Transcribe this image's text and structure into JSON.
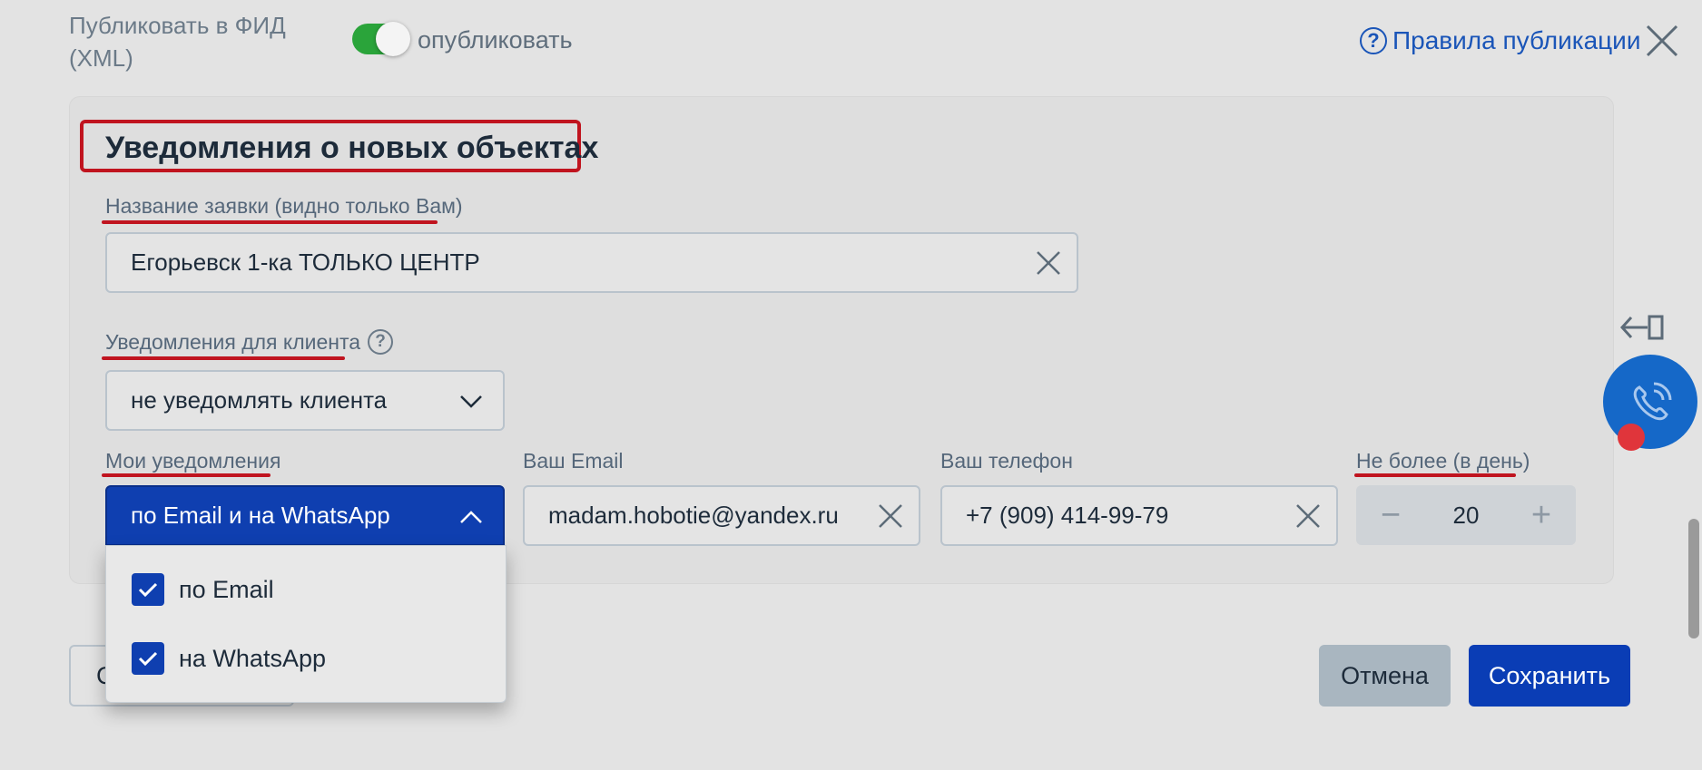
{
  "header": {
    "feed_label": "Публиковать в ФИД (XML)",
    "publish_toggle_label": "опубликовать",
    "publish_toggle_on": true,
    "rules_link": "Правила публикации",
    "help_glyph": "?"
  },
  "section": {
    "title": "Уведомления о новых объектах",
    "request_name_label": "Название заявки (видно только Вам)",
    "request_name_value": "Егорьевск 1-ка ТОЛЬКО ЦЕНТР",
    "client_notify_label": "Уведомления для клиента",
    "client_notify_value": "не уведомлять клиента",
    "my_notify_label": "Мои уведомления",
    "my_notify_value": "по Email и на WhatsApp",
    "my_notify_options": [
      {
        "label": "по Email",
        "checked": true
      },
      {
        "label": "на WhatsApp",
        "checked": true
      }
    ],
    "email_label": "Ваш Email",
    "email_value": "madam.hobotie@yandex.ru",
    "phone_label": "Ваш телефон",
    "phone_value": "+7 (909) 414-99-79",
    "limit_label": "Не более (в день)",
    "limit_value": "20",
    "minus_glyph": "−",
    "plus_glyph": "+"
  },
  "footer": {
    "left_button_partial": "С",
    "cancel_label": "Отмена",
    "save_label": "Сохранить"
  },
  "icons": [
    "help-icon",
    "close-icon",
    "clear-icon",
    "chevron-down-icon",
    "chevron-up-icon",
    "checkbox-checked-icon",
    "collapse-panel-icon",
    "phone-call-icon"
  ],
  "colors": {
    "accent_blue": "#0f3fb0",
    "link_blue": "#1a55b8",
    "highlight_red": "#c0141f",
    "toggle_green": "#2aa43a",
    "call_blue": "#1568c8"
  }
}
